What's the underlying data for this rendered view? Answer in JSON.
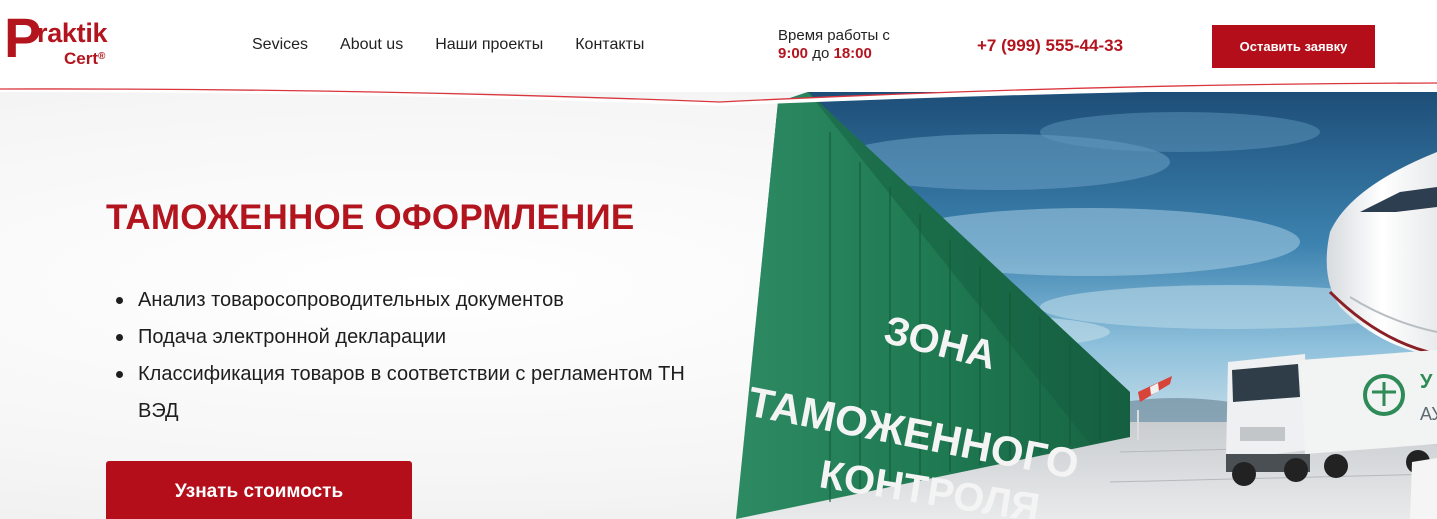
{
  "logo": {
    "p": "P",
    "raktik": "raktik",
    "cert": "Cert",
    "reg": "®"
  },
  "nav": {
    "items": [
      {
        "label": "Sevices"
      },
      {
        "label": "About us"
      },
      {
        "label": "Наши проекты"
      },
      {
        "label": "Контакты"
      }
    ]
  },
  "hours": {
    "label": "Время работы с",
    "from": "9:00",
    "to_word": "до",
    "to": "18:00"
  },
  "phone": "+7 (999) 555-44-33",
  "header_cta": "Оставить заявку",
  "hero": {
    "title": "ТАМОЖЕННОЕ ОФОРМЛЕНИЕ",
    "bullets": [
      "Анализ товаросопроводительных документов",
      "Подача электронной декларации",
      "Классификация товаров в соответствии с регламентом ТН ВЭД"
    ],
    "cta": "Узнать стоимость"
  },
  "photo": {
    "sign_lines": [
      "ЗОНА",
      "ТАМОЖЕННОГО",
      "КОНТРОЛЯ"
    ],
    "truck_text": [
      "У",
      "АУ"
    ]
  },
  "colors": {
    "brand": "#b3151f",
    "button": "#b30e19",
    "container_green": "#1f7a52",
    "sky": "#2d6f9c"
  }
}
